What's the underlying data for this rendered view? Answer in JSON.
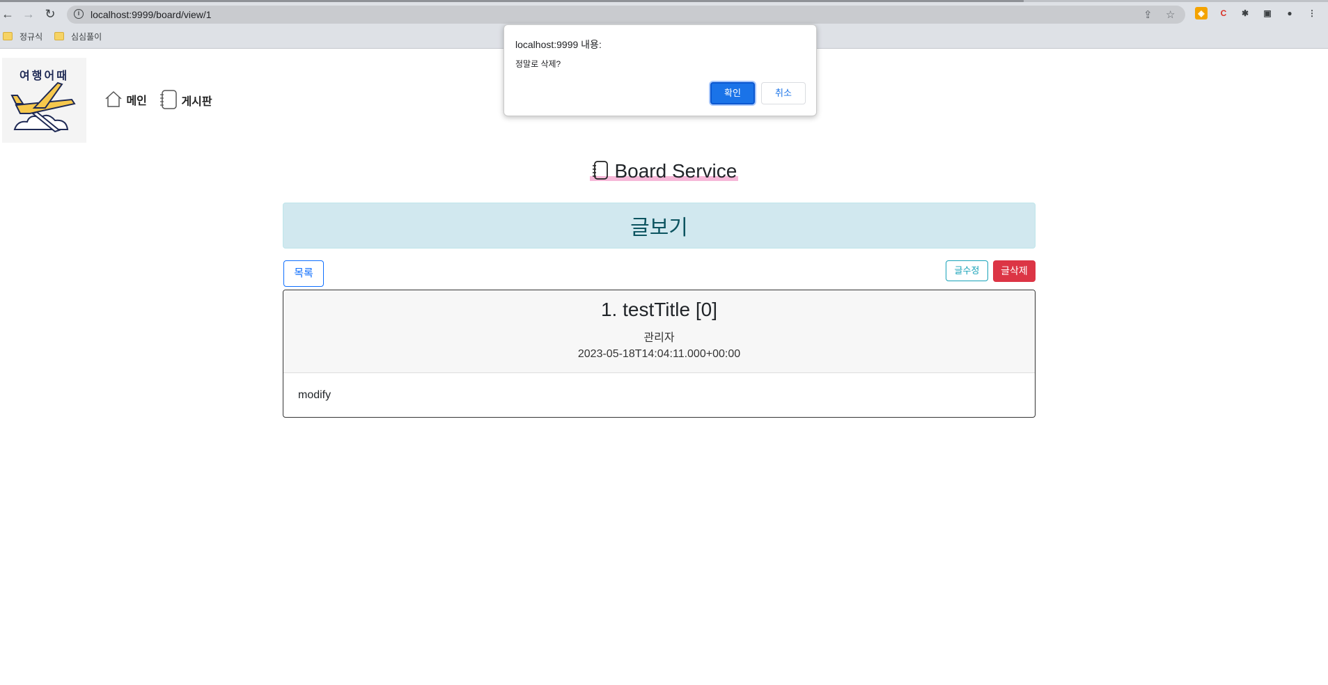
{
  "browser": {
    "url": "localhost:9999/board/view/1",
    "bookmarks": [
      "정규식",
      "심심풀이"
    ]
  },
  "site": {
    "logo_text": "여행어때",
    "nav": [
      {
        "label": "메인",
        "icon": "home-icon"
      },
      {
        "label": "게시판",
        "icon": "notebook-icon"
      }
    ]
  },
  "page": {
    "title": "Board Service",
    "heading": "글보기"
  },
  "toolbar": {
    "list_label": "목록",
    "edit_label": "글수정",
    "delete_label": "글삭제"
  },
  "post": {
    "title": "1. testTitle [0]",
    "writer": "관리자",
    "date": "2023-05-18T14:04:11.000+00:00",
    "content": "modify"
  },
  "dialog": {
    "title": "localhost:9999 내용:",
    "message": "정말로 삭제?",
    "ok_label": "확인",
    "cancel_label": "취소"
  },
  "colors": {
    "primary": "#0d6efd",
    "info": "#17a2b8",
    "danger": "#dc3545",
    "heading_bg": "#d1e8ef"
  }
}
